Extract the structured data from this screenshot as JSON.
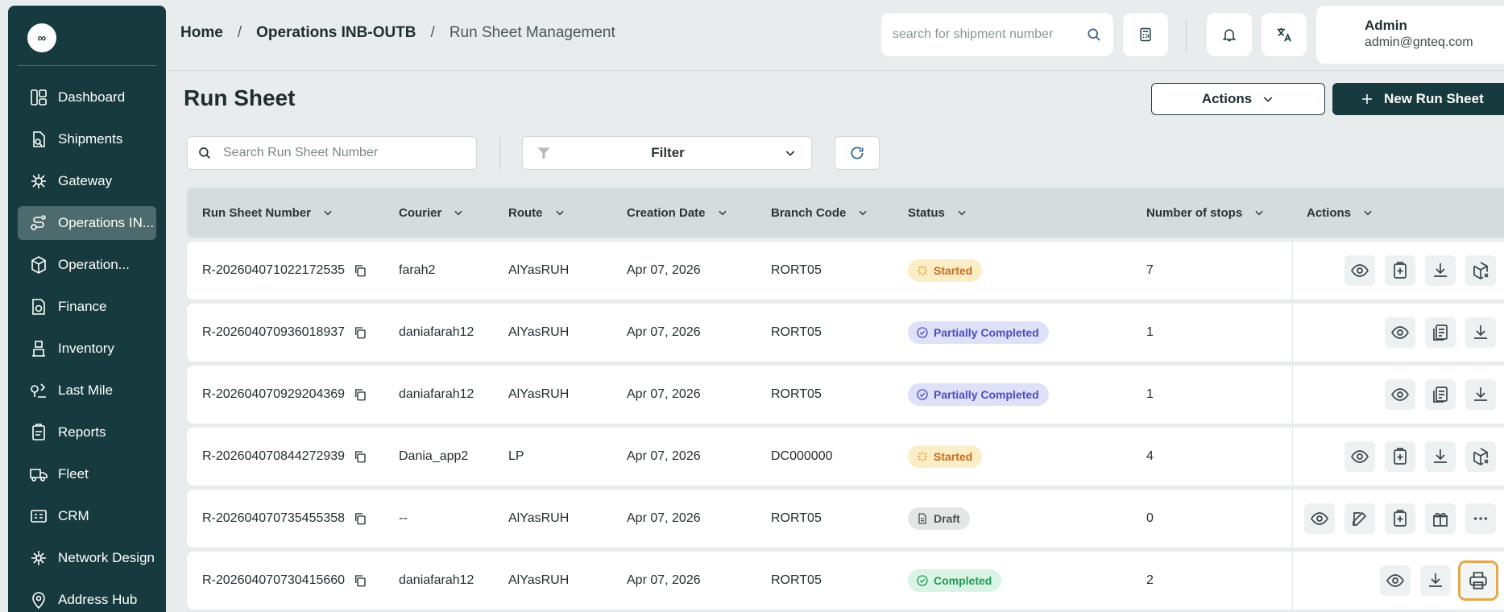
{
  "sidebar": {
    "logo": "∞",
    "items": [
      {
        "label": "Dashboard",
        "icon": "dashboard-icon",
        "active": false
      },
      {
        "label": "Shipments",
        "icon": "shipments-icon",
        "active": false
      },
      {
        "label": "Gateway",
        "icon": "gateway-icon",
        "active": false
      },
      {
        "label": "Operations IN...",
        "icon": "operations-route-icon",
        "active": true
      },
      {
        "label": "Operation...",
        "icon": "operation-box-icon",
        "active": false
      },
      {
        "label": "Finance",
        "icon": "finance-icon",
        "active": false
      },
      {
        "label": "Inventory",
        "icon": "inventory-icon",
        "active": false
      },
      {
        "label": "Last Mile",
        "icon": "last-mile-icon",
        "active": false
      },
      {
        "label": "Reports",
        "icon": "reports-icon",
        "active": false
      },
      {
        "label": "Fleet",
        "icon": "fleet-icon",
        "active": false
      },
      {
        "label": "CRM",
        "icon": "crm-icon",
        "active": false
      },
      {
        "label": "Network Design",
        "icon": "network-design-icon",
        "active": false
      },
      {
        "label": "Address Hub",
        "icon": "address-hub-icon",
        "active": false
      }
    ]
  },
  "header": {
    "breadcrumb": {
      "home": "Home",
      "section": "Operations INB-OUTB",
      "current": "Run Sheet Management",
      "sep": "/"
    },
    "search_placeholder": "search for shipment number",
    "user": {
      "name": "Admin",
      "email": "admin@gnteq.com"
    }
  },
  "page": {
    "title": "Run Sheet",
    "actions_label": "Actions",
    "new_label": "New Run Sheet",
    "search_placeholder": "Search Run Sheet Number",
    "filter_label": "Filter"
  },
  "table": {
    "columns": [
      "Run Sheet Number",
      "Courier",
      "Route",
      "Creation Date",
      "Branch Code",
      "Status",
      "Number of stops",
      "Actions"
    ],
    "rows": [
      {
        "number": "R-202604071022172535",
        "courier": "farah2",
        "route": "AlYasRUH",
        "date": "Apr 07, 2026",
        "branch": "RORT05",
        "status": "Started",
        "stops": "7"
      },
      {
        "number": "R-202604070936018937",
        "courier": "daniafarah12",
        "route": "AlYasRUH",
        "date": "Apr 07, 2026",
        "branch": "RORT05",
        "status": "Partially Completed",
        "stops": "1"
      },
      {
        "number": "R-202604070929204369",
        "courier": "daniafarah12",
        "route": "AlYasRUH",
        "date": "Apr 07, 2026",
        "branch": "RORT05",
        "status": "Partially Completed",
        "stops": "1"
      },
      {
        "number": "R-202604070844272939",
        "courier": "Dania_app2",
        "route": "LP",
        "date": "Apr 07, 2026",
        "branch": "DC000000",
        "status": "Started",
        "stops": "4"
      },
      {
        "number": "R-202604070735455358",
        "courier": "--",
        "route": "AlYasRUH",
        "date": "Apr 07, 2026",
        "branch": "RORT05",
        "status": "Draft",
        "stops": "0"
      },
      {
        "number": "R-202604070730415660",
        "courier": "daniafarah12",
        "route": "AlYasRUH",
        "date": "Apr 07, 2026",
        "branch": "RORT05",
        "status": "Completed",
        "stops": "2"
      }
    ]
  }
}
